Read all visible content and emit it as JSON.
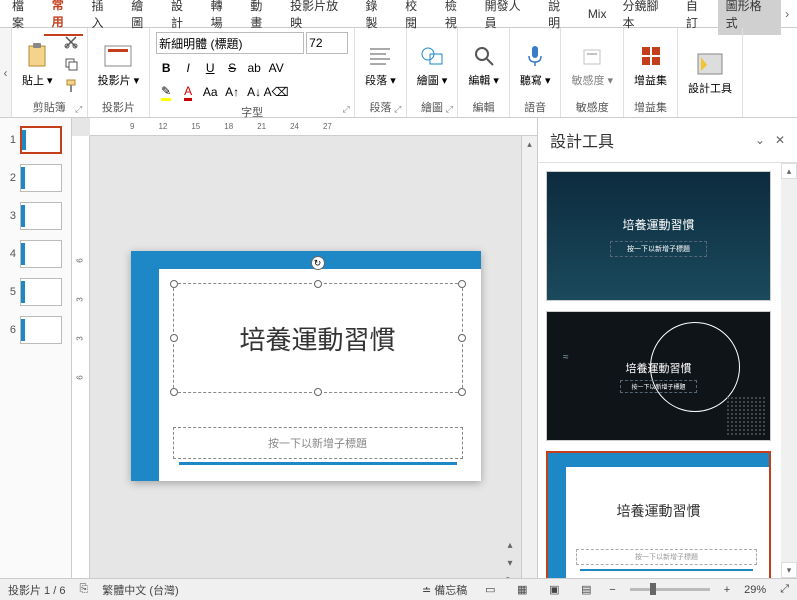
{
  "tabs": {
    "file": "檔案",
    "home": "常用",
    "insert": "插入",
    "draw": "繪圖",
    "design": "設計",
    "transitions": "轉場",
    "animations": "動畫",
    "slideshow": "投影片放映",
    "record": "錄製",
    "review": "校閱",
    "view": "檢視",
    "developer": "開發人員",
    "help": "說明",
    "mix": "Mix",
    "storyboard": "分鏡腳本",
    "custom": "自訂",
    "shape_format": "圖形格式"
  },
  "ribbon": {
    "paste": "貼上",
    "clipboard_label": "剪貼簿",
    "slides_btn": "投影片",
    "slides_label": "投影片",
    "font_name": "新細明體 (標題)",
    "font_size": "72",
    "bold": "B",
    "italic": "I",
    "underline": "U",
    "strike": "S",
    "font_label": "字型",
    "paragraph_btn": "段落",
    "paragraph_label": "段落",
    "drawing_btn": "繪圖",
    "drawing_label": "繪圖",
    "editing_btn": "編輯",
    "editing_label": "編輯",
    "dictate_btn": "聽寫",
    "voice_label": "語音",
    "sensitivity_btn": "敏感度",
    "sensitivity_label": "敏感度",
    "addins_btn": "增益集",
    "addins_label": "增益集",
    "designer_btn": "設計工具",
    "size_smaller": "Aa",
    "spacing": "AV"
  },
  "ruler": {
    "h": [
      "9",
      "12",
      "15",
      "18",
      "21",
      "24",
      "27"
    ],
    "v": [
      "6",
      "3",
      "3",
      "6"
    ]
  },
  "slide": {
    "title": "培養運動習慣",
    "subtitle_placeholder": "按一下以新增子標題"
  },
  "designer": {
    "title": "設計工具",
    "opt1_title": "培養運動習慣",
    "opt1_sub": "按一下以新增子標題",
    "opt2_title": "培養運動習慣",
    "opt2_sub": "按一下以新增子標題",
    "opt3_title": "培養運動習慣",
    "opt3_sub": "按一下以新增子標題"
  },
  "status": {
    "slide_info": "投影片 1 / 6",
    "language": "繁體中文 (台灣)",
    "notes": "備忘稿",
    "zoom": "29%"
  },
  "thumbs": [
    "1",
    "2",
    "3",
    "4",
    "5",
    "6"
  ]
}
